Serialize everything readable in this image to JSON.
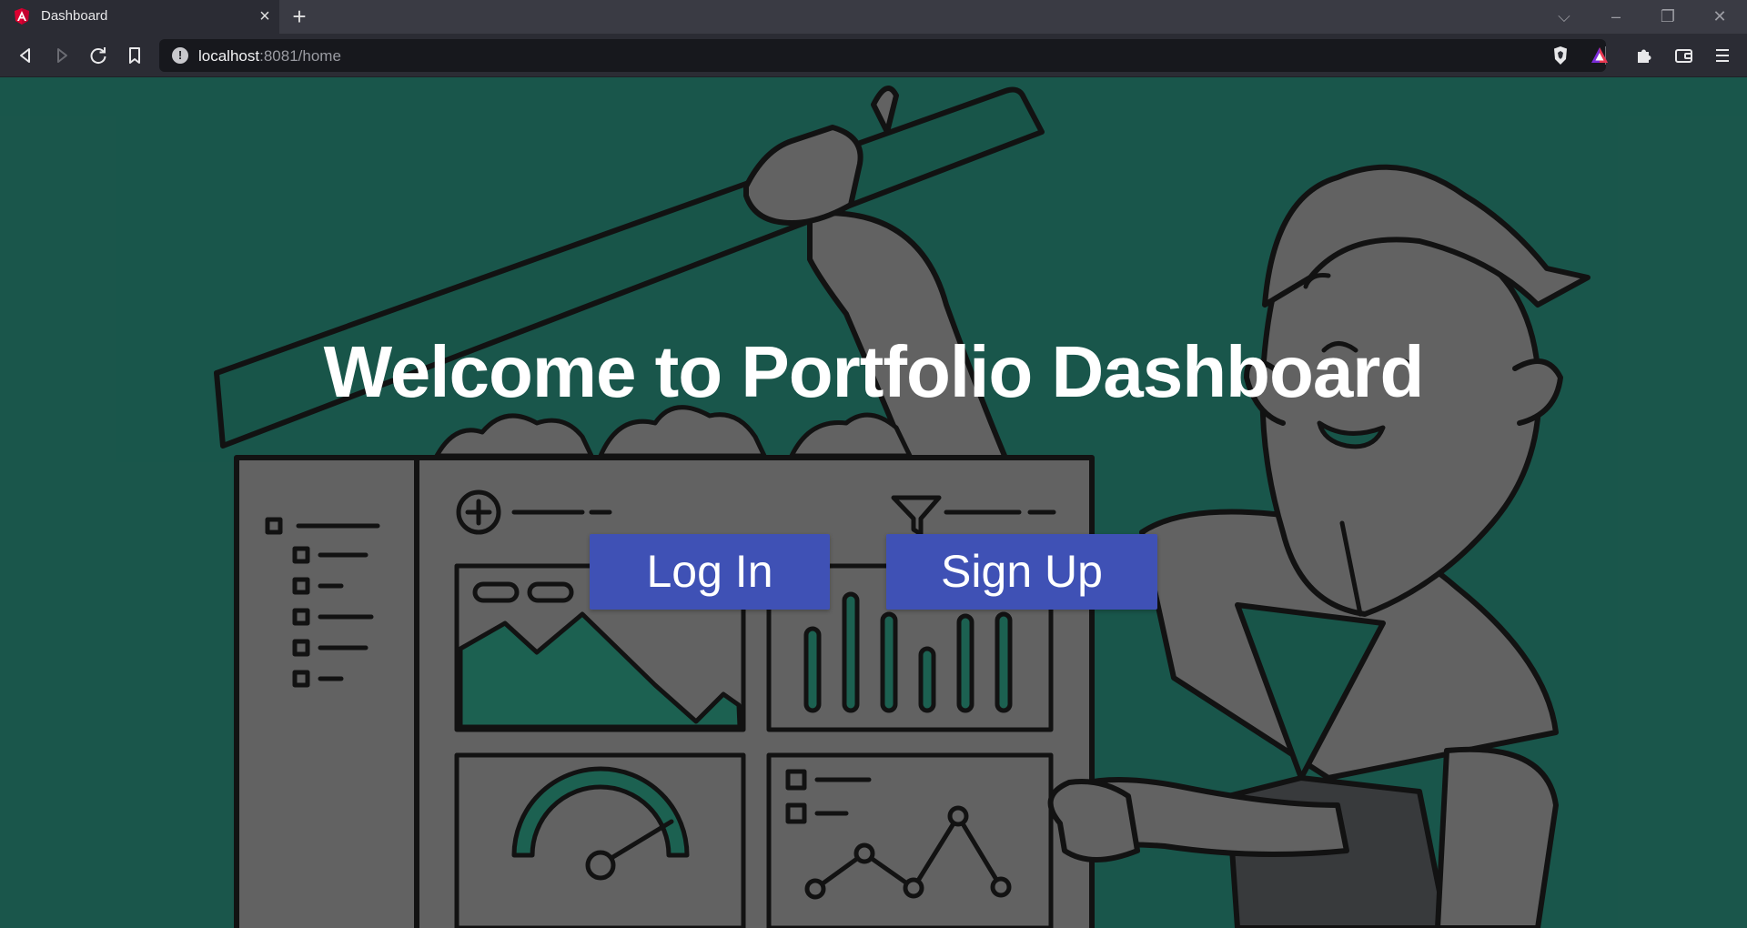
{
  "browser": {
    "tab_title": "Dashboard",
    "url_host": "localhost",
    "url_rest": ":8081/home",
    "icons": {
      "favicon": "angular-icon",
      "back": "back-icon",
      "forward": "forward-icon",
      "reload": "reload-icon",
      "bookmark": "bookmark-icon",
      "site_info": "info-icon",
      "brave_shield": "brave-shield-icon",
      "rewards": "brave-rewards-icon",
      "extensions": "puzzle-icon",
      "wallet": "wallet-icon",
      "menu": "hamburger-menu-icon"
    },
    "accent_color": "#dd0031"
  },
  "page": {
    "headline": "Welcome to Portfolio Dashboard",
    "login_label": "Log In",
    "signup_label": "Sign Up",
    "background_color": "#1c5e52",
    "button_color": "#3f51b5"
  }
}
